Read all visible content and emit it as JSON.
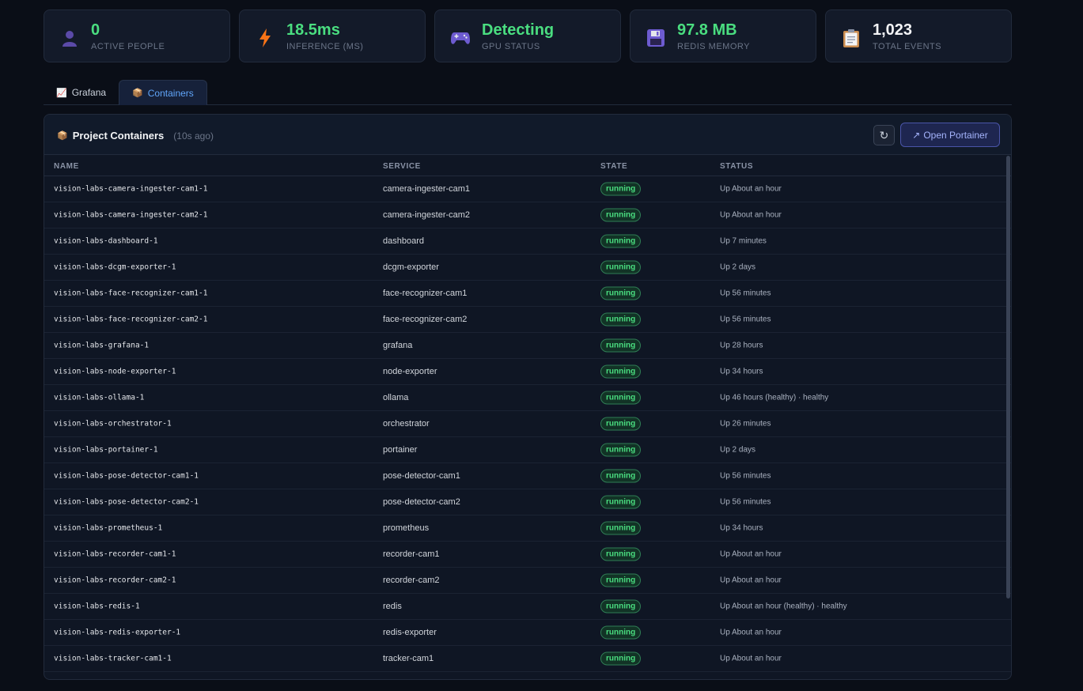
{
  "stats": [
    {
      "value": "0",
      "label": "ACTIVE PEOPLE",
      "icon": "person-icon",
      "color": "#4ade80"
    },
    {
      "value": "18.5ms",
      "label": "INFERENCE (MS)",
      "icon": "lightning-icon",
      "color": "#4ade80"
    },
    {
      "value": "Detecting",
      "label": "GPU STATUS",
      "icon": "gamepad-icon",
      "color": "#4ade80"
    },
    {
      "value": "97.8 MB",
      "label": "REDIS MEMORY",
      "icon": "floppy-disk-icon",
      "color": "#4ade80"
    },
    {
      "value": "1,023",
      "label": "TOTAL EVENTS",
      "icon": "clipboard-icon",
      "color": "#f3f4f6"
    }
  ],
  "tabs": [
    {
      "label": "Grafana",
      "icon": "chart-icon",
      "active": false
    },
    {
      "label": "Containers",
      "icon": "package-icon",
      "active": true
    }
  ],
  "panel": {
    "title": "Project Containers",
    "updated": "(10s ago)",
    "refresh_icon": "↻",
    "open_button_icon": "↗",
    "open_button": "Open Portainer"
  },
  "table": {
    "headers": {
      "name": "NAME",
      "service": "SERVICE",
      "state": "STATE",
      "status": "STATUS"
    },
    "rows": [
      {
        "name": "vision-labs-camera-ingester-cam1-1",
        "service": "camera-ingester-cam1",
        "state": "running",
        "status": "Up About an hour"
      },
      {
        "name": "vision-labs-camera-ingester-cam2-1",
        "service": "camera-ingester-cam2",
        "state": "running",
        "status": "Up About an hour"
      },
      {
        "name": "vision-labs-dashboard-1",
        "service": "dashboard",
        "state": "running",
        "status": "Up 7 minutes"
      },
      {
        "name": "vision-labs-dcgm-exporter-1",
        "service": "dcgm-exporter",
        "state": "running",
        "status": "Up 2 days"
      },
      {
        "name": "vision-labs-face-recognizer-cam1-1",
        "service": "face-recognizer-cam1",
        "state": "running",
        "status": "Up 56 minutes"
      },
      {
        "name": "vision-labs-face-recognizer-cam2-1",
        "service": "face-recognizer-cam2",
        "state": "running",
        "status": "Up 56 minutes"
      },
      {
        "name": "vision-labs-grafana-1",
        "service": "grafana",
        "state": "running",
        "status": "Up 28 hours"
      },
      {
        "name": "vision-labs-node-exporter-1",
        "service": "node-exporter",
        "state": "running",
        "status": "Up 34 hours"
      },
      {
        "name": "vision-labs-ollama-1",
        "service": "ollama",
        "state": "running",
        "status": "Up 46 hours (healthy) · healthy"
      },
      {
        "name": "vision-labs-orchestrator-1",
        "service": "orchestrator",
        "state": "running",
        "status": "Up 26 minutes"
      },
      {
        "name": "vision-labs-portainer-1",
        "service": "portainer",
        "state": "running",
        "status": "Up 2 days"
      },
      {
        "name": "vision-labs-pose-detector-cam1-1",
        "service": "pose-detector-cam1",
        "state": "running",
        "status": "Up 56 minutes"
      },
      {
        "name": "vision-labs-pose-detector-cam2-1",
        "service": "pose-detector-cam2",
        "state": "running",
        "status": "Up 56 minutes"
      },
      {
        "name": "vision-labs-prometheus-1",
        "service": "prometheus",
        "state": "running",
        "status": "Up 34 hours"
      },
      {
        "name": "vision-labs-recorder-cam1-1",
        "service": "recorder-cam1",
        "state": "running",
        "status": "Up About an hour"
      },
      {
        "name": "vision-labs-recorder-cam2-1",
        "service": "recorder-cam2",
        "state": "running",
        "status": "Up About an hour"
      },
      {
        "name": "vision-labs-redis-1",
        "service": "redis",
        "state": "running",
        "status": "Up About an hour (healthy) · healthy"
      },
      {
        "name": "vision-labs-redis-exporter-1",
        "service": "redis-exporter",
        "state": "running",
        "status": "Up About an hour"
      },
      {
        "name": "vision-labs-tracker-cam1-1",
        "service": "tracker-cam1",
        "state": "running",
        "status": "Up About an hour"
      }
    ]
  }
}
